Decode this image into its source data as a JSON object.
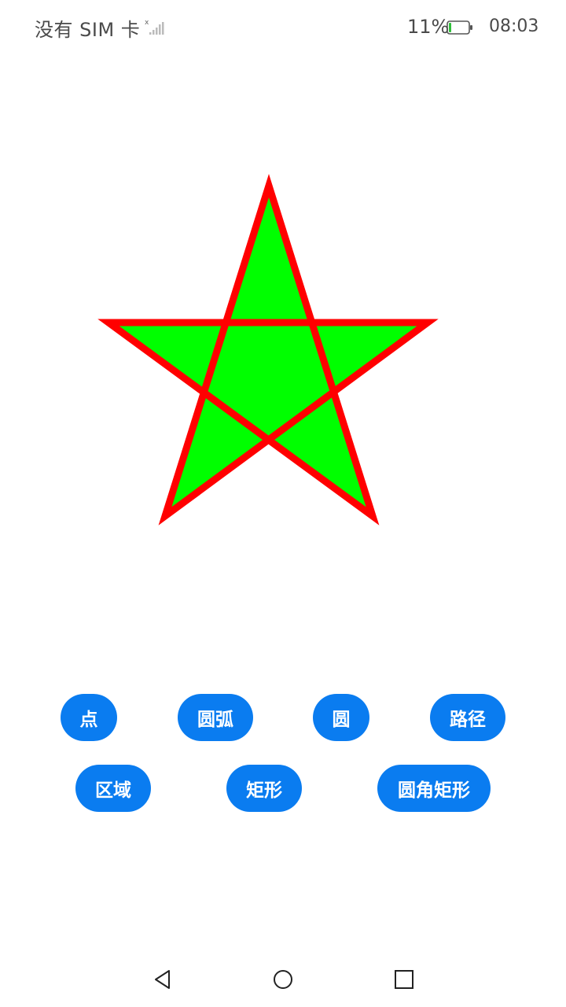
{
  "status_bar": {
    "carrier": "没有 SIM 卡",
    "battery_percent": "11%",
    "time": "08:03"
  },
  "shape": {
    "kind": "star",
    "fill_color": "#00ff00",
    "stroke_color": "#ff0000"
  },
  "buttons": {
    "point": "点",
    "arc": "圆弧",
    "circle": "圆",
    "path": "路径",
    "region": "区域",
    "rect": "矩形",
    "round_rect": "圆角矩形"
  },
  "nav": {
    "back": "back-icon",
    "home": "home-icon",
    "recents": "recents-icon"
  }
}
